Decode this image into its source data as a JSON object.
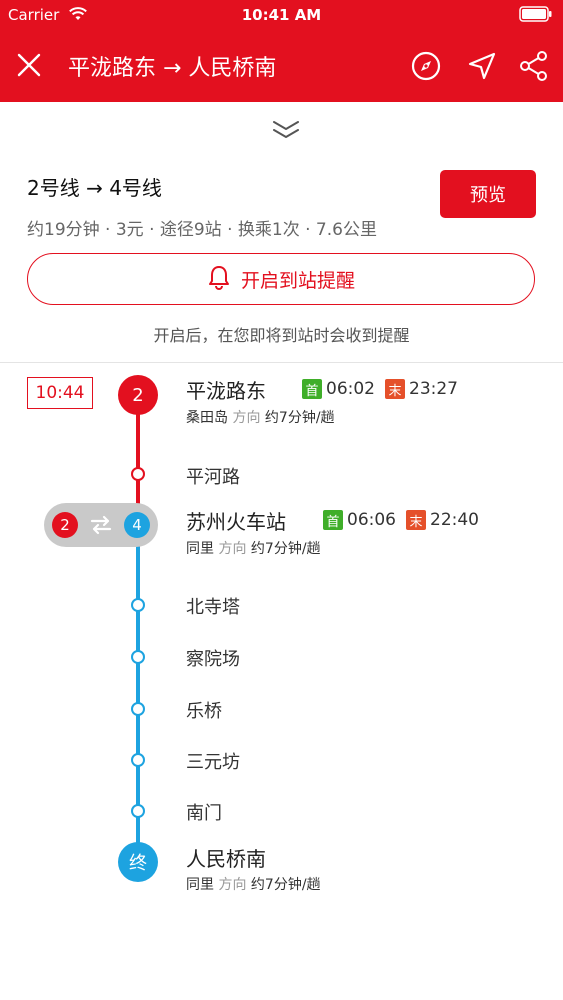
{
  "status_bar": {
    "carrier": "Carrier",
    "time": "10:41 AM"
  },
  "header": {
    "title": "平泷路东 → 人民桥南"
  },
  "route": {
    "lines": "2号线 → 4号线",
    "meta": "约19分钟 · 3元 · 途径9站 · 换乘1次 · 7.6公里",
    "preview_label": "预览",
    "alarm_label": "开启到站提醒",
    "alarm_hint": "开启后，在您即将到站时会收到提醒"
  },
  "colors": {
    "brand": "#e3101f",
    "line2": "#e3101f",
    "line4": "#1da3e0",
    "first_tag": "#3fae29",
    "last_tag": "#e5502a"
  },
  "timeline": {
    "depart_time": "10:44",
    "first_label": "首",
    "last_label": "末",
    "direction_word": "方向",
    "start": {
      "line_badge": "2",
      "name": "平泷路东",
      "first_time": "06:02",
      "last_time": "23:27",
      "direction_station": "桑田岛",
      "interval": "约7分钟/趟"
    },
    "stop1": "平河路",
    "transfer": {
      "from_line": "2",
      "to_line": "4",
      "name": "苏州火车站",
      "first_time": "06:06",
      "last_time": "22:40",
      "direction_station": "同里",
      "interval": "约7分钟/趟"
    },
    "stops": [
      "北寺塔",
      "察院场",
      "乐桥",
      "三元坊",
      "南门"
    ],
    "end": {
      "badge": "终",
      "name": "人民桥南",
      "direction_station": "同里",
      "interval": "约7分钟/趟"
    }
  }
}
